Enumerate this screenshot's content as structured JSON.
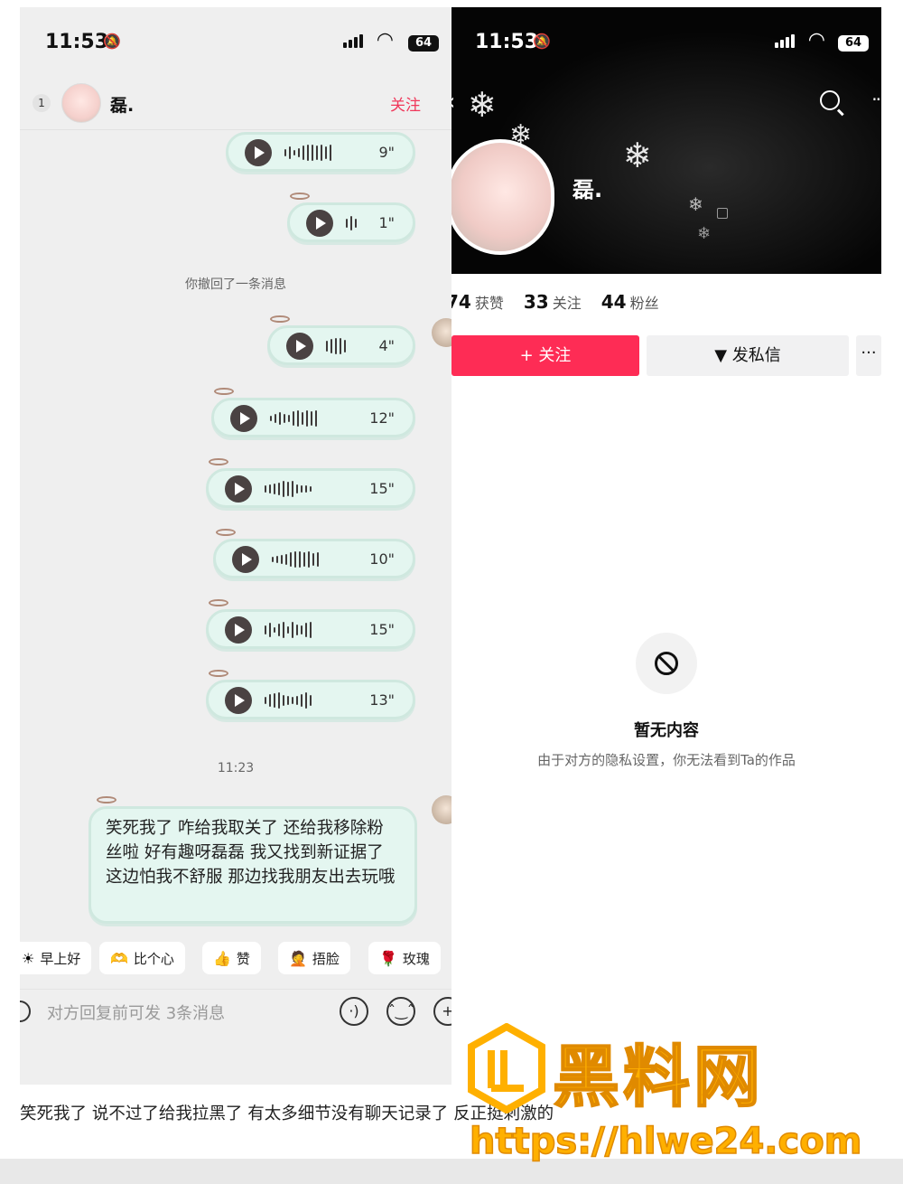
{
  "chat": {
    "status": {
      "time": "11:53",
      "battery": "64"
    },
    "header": {
      "unread": "1",
      "name": "磊.",
      "follow": "关注"
    },
    "voice_messages": [
      "9\"",
      "1\"",
      "4\"",
      "12\"",
      "15\"",
      "10\"",
      "15\"",
      "13\""
    ],
    "recall_notice": "你撤回了一条消息",
    "timestamp": "11:23",
    "text_message": "笑死我了 咋给我取关了 还给我移除粉丝啦 好有趣呀磊磊 我又找到新证据了 这边怕我不舒服 那边找我朋友出去玩哦",
    "quick_replies": [
      {
        "emoji": "☀",
        "label": "早上好"
      },
      {
        "emoji": "🫶",
        "label": "比个心"
      },
      {
        "emoji": "👍",
        "label": "赞"
      },
      {
        "emoji": "🤦",
        "label": "捂脸"
      },
      {
        "emoji": "🌹",
        "label": "玫瑰"
      }
    ],
    "input_placeholder": "对方回复前可发 3条消息"
  },
  "profile": {
    "status": {
      "time": "11:53",
      "battery": "64"
    },
    "name": "磊.",
    "stats": [
      {
        "num": "74",
        "label": "获赞"
      },
      {
        "num": "33",
        "label": "关注"
      },
      {
        "num": "44",
        "label": "粉丝"
      }
    ],
    "follow_button": "+ 关注",
    "message_button": "发私信",
    "more_button": "···",
    "empty_title": "暂无内容",
    "empty_desc": "由于对方的隐私设置，你无法看到Ta的作品"
  },
  "caption": "笑死我了 说不过了给我拉黑了 有太多细节没有聊天记录了 反正挺刺激的",
  "watermark": {
    "text": "黑料网",
    "url": "https://hlwe24.com",
    "color": "#ffb000"
  }
}
